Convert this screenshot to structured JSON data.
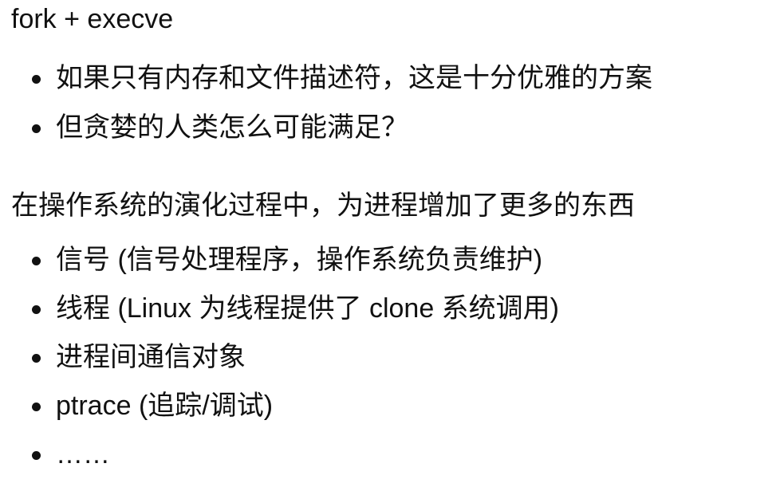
{
  "section1": {
    "heading": "fork + execve",
    "items": [
      "如果只有内存和文件描述符，这是十分优雅的方案",
      "但贪婪的人类怎么可能满足？"
    ]
  },
  "section2": {
    "heading": "在操作系统的演化过程中，为进程增加了更多的东西",
    "items": [
      "信号 (信号处理程序，操作系统负责维护)",
      "线程 (Linux 为线程提供了 clone 系统调用)",
      "进程间通信对象",
      "ptrace (追踪/调试)",
      "……"
    ]
  }
}
